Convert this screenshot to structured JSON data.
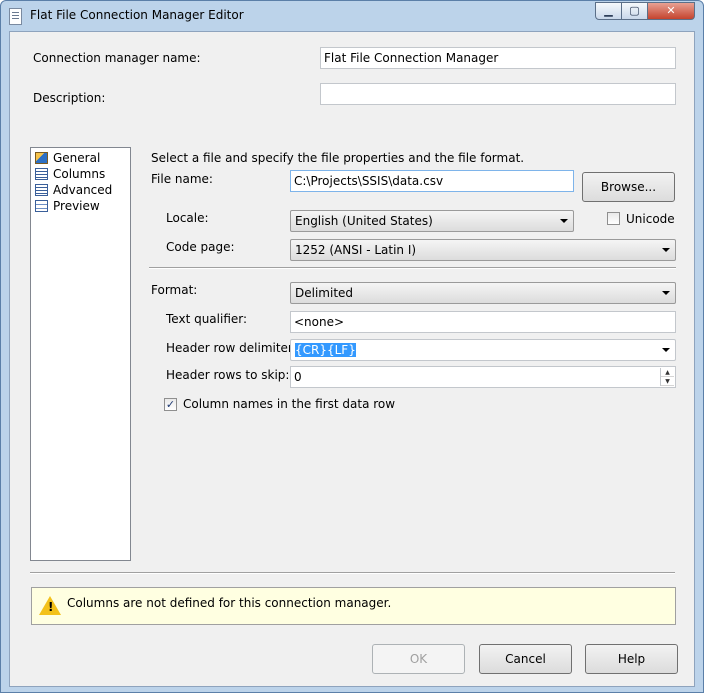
{
  "window": {
    "title": "Flat File Connection Manager Editor",
    "min_glyph": "▁",
    "max_glyph": "▢",
    "close_glyph": "✕"
  },
  "header": {
    "conn_name_label": "Connection manager name:",
    "conn_name_value": "Flat File Connection Manager",
    "description_label": "Description:",
    "description_value": ""
  },
  "nav": {
    "items": [
      {
        "label": "General",
        "icon": "general-icon"
      },
      {
        "label": "Columns",
        "icon": "columns-icon"
      },
      {
        "label": "Advanced",
        "icon": "advanced-icon"
      },
      {
        "label": "Preview",
        "icon": "preview-icon"
      }
    ]
  },
  "general": {
    "instruction": "Select a file and specify the file properties and the file format.",
    "file_name_label": "File name:",
    "file_name_value": "C:\\Projects\\SSIS\\data.csv",
    "browse_label": "Browse...",
    "locale_label": "Locale:",
    "locale_value": "English (United States)",
    "unicode_label": "Unicode",
    "unicode_checked": false,
    "code_page_label": "Code page:",
    "code_page_value": "1252  (ANSI - Latin I)",
    "format_label": "Format:",
    "format_value": "Delimited",
    "text_qualifier_label": "Text qualifier:",
    "text_qualifier_value": "<none>",
    "header_row_delim_label": "Header row delimiter:",
    "header_row_delim_value": "{CR}{LF}",
    "header_rows_skip_label": "Header rows to skip:",
    "header_rows_skip_value": "0",
    "col_names_label": "Column names in the first data row",
    "col_names_checked": true,
    "check_glyph": "✓"
  },
  "message": {
    "text": "Columns are not defined for this connection manager.",
    "icon": "warning-icon",
    "icon_glyph": "!"
  },
  "buttons": {
    "ok": "OK",
    "cancel": "Cancel",
    "help": "Help"
  },
  "colors": {
    "title_bg": "#bcd3ea",
    "message_bg": "#ffffe1",
    "selection": "#3399ff"
  }
}
